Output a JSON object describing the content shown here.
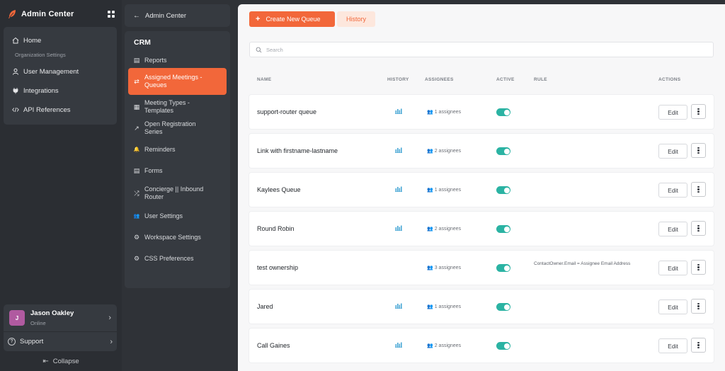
{
  "brand": {
    "title": "Admin Center",
    "icon": "feather-icon",
    "apps_icon": "grid-icon"
  },
  "sidebar": {
    "items": [
      {
        "label": "Home",
        "icon": "home-icon"
      },
      {
        "label": "User Management",
        "icon": "user-icon"
      },
      {
        "label": "Integrations",
        "icon": "plug-icon"
      },
      {
        "label": "API References",
        "icon": "code-icon"
      }
    ],
    "sub_label": "Organization Settings"
  },
  "user": {
    "initial": "J",
    "name": "Jason Oakley",
    "status": "Online",
    "avatar_color": "#b05aa0"
  },
  "support": {
    "label": "Support"
  },
  "collapse": {
    "label": "Collapse"
  },
  "midnav": {
    "back_label": "Admin Center",
    "section": "CRM",
    "items": [
      {
        "label": "Reports",
        "icon": "report-icon"
      },
      {
        "label": "Assigned Meetings - Queues",
        "icon": "swap-icon"
      },
      {
        "label": "Meeting Types - Templates",
        "icon": "calendar-icon"
      },
      {
        "label": "Open Registration Series",
        "icon": "arrow-up-right-icon"
      },
      {
        "label": "Reminders",
        "icon": "bell-icon"
      },
      {
        "label": "Forms",
        "icon": "form-icon"
      },
      {
        "label": "Concierge || Inbound Router",
        "icon": "shuffle-icon"
      },
      {
        "label": "User Settings",
        "icon": "users-icon"
      },
      {
        "label": "Workspace Settings",
        "icon": "gear-icon"
      },
      {
        "label": "CSS Preferences",
        "icon": "gear-icon"
      }
    ],
    "active_index": 1
  },
  "toolbar": {
    "create_label": "Create New Queue",
    "history_label": "History"
  },
  "search": {
    "placeholder": "Search"
  },
  "table": {
    "columns": [
      "NAME",
      "HISTORY",
      "ASSIGNEES",
      "ACTIVE",
      "RULE",
      "ACTIONS"
    ],
    "rows": [
      {
        "name": "support-router queue",
        "history": true,
        "assignees": "1 assignees",
        "active": true,
        "rule": ""
      },
      {
        "name": "Link with firstname-lastname",
        "history": true,
        "assignees": "2 assignees",
        "active": true,
        "rule": ""
      },
      {
        "name": "Kaylees Queue",
        "history": true,
        "assignees": "1 assignees",
        "active": true,
        "rule": ""
      },
      {
        "name": "Round Robin",
        "history": true,
        "assignees": "2 assignees",
        "active": true,
        "rule": ""
      },
      {
        "name": "test ownership",
        "history": false,
        "assignees": "3 assignees",
        "active": true,
        "rule": "ContactOwner.Email = Assignee Email Address"
      },
      {
        "name": "Jared",
        "history": true,
        "assignees": "1 assignees",
        "active": true,
        "rule": ""
      },
      {
        "name": "Call Gaines",
        "history": true,
        "assignees": "2 assignees",
        "active": true,
        "rule": ""
      }
    ],
    "edit_label": "Edit"
  },
  "colors": {
    "accent": "#f2673a",
    "toggle_on": "#2bb3a3",
    "sidebar_bg": "#2b2e33",
    "panel_bg": "#363a40"
  }
}
